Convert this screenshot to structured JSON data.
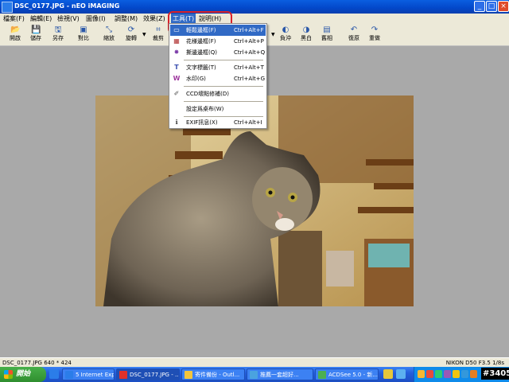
{
  "window": {
    "title": "DSC_0177.JPG - nEO iMAGING",
    "minimize": "_",
    "maximize": "□",
    "close": "×"
  },
  "menubar": {
    "items": [
      "檔案(F)",
      "編輯(E)",
      "檢視(V)",
      "圖像(I)",
      "調整(M)",
      "效果(Z)",
      "工具(T)",
      "說明(H)"
    ]
  },
  "toolbar": {
    "buttons": [
      {
        "label": "開啟",
        "icon": "folder-open-icon",
        "glyph": "📂"
      },
      {
        "label": "儲存",
        "icon": "save-disk-icon",
        "glyph": "💾"
      },
      {
        "label": "另存",
        "icon": "save-as-icon",
        "glyph": "🖫"
      },
      {
        "label": "對比",
        "icon": "compare-icon",
        "glyph": "▣"
      },
      {
        "label": "縮放",
        "icon": "resize-icon",
        "glyph": "⤡"
      },
      {
        "label": "旋轉",
        "icon": "rotate-icon",
        "glyph": "⟳"
      },
      {
        "label": "裁剪",
        "icon": "crop-icon",
        "glyph": "⌗"
      },
      {
        "label": "負沖",
        "icon": "negative-icon",
        "glyph": "◐"
      },
      {
        "label": "黑白",
        "icon": "grayscale-icon",
        "glyph": "◑"
      },
      {
        "label": "舊相",
        "icon": "sepia-icon",
        "glyph": "▤"
      },
      {
        "label": "復原",
        "icon": "undo-icon",
        "glyph": "↶"
      },
      {
        "label": "重做",
        "icon": "redo-icon",
        "glyph": "↷"
      }
    ]
  },
  "tools_menu": {
    "items": [
      {
        "label": "輕鬆邊框(F)",
        "shortcut": "Ctrl+Alt+F",
        "icon": "frame-icon",
        "glyph": "▭",
        "highlighted": true
      },
      {
        "label": "花様邊框(F)",
        "shortcut": "Ctrl+Alt+P",
        "icon": "pattern-frame-icon",
        "glyph": "▦",
        "highlighted": false
      },
      {
        "label": "撕邊邊框(Q)",
        "shortcut": "Ctrl+Alt+Q",
        "icon": "torn-frame-icon",
        "glyph": "✸",
        "highlighted": false
      },
      {
        "label": "文字標籤(T)",
        "shortcut": "Ctrl+Alt+T",
        "icon": "text-label-icon",
        "glyph": "T",
        "highlighted": false
      },
      {
        "label": "水印(G)",
        "shortcut": "Ctrl+Alt+G",
        "icon": "watermark-icon",
        "glyph": "W",
        "highlighted": false
      },
      {
        "label": "CCD壞點修補(D)",
        "shortcut": "",
        "icon": "ccd-repair-icon",
        "glyph": "✐",
        "highlighted": false
      },
      {
        "label": "設定爲桌布(W)",
        "shortcut": "",
        "icon": "",
        "glyph": "",
        "highlighted": false
      },
      {
        "label": "EXIF訊息(X)",
        "shortcut": "Ctrl+Alt+I",
        "icon": "exif-info-icon",
        "glyph": "ℹ",
        "highlighted": false
      }
    ]
  },
  "statusbar": {
    "file_info": "DSC_0177.JPG  640 * 424",
    "camera_info": "NIKON D50 F3.5 1/8s"
  },
  "taskbar": {
    "start_label": "開始",
    "tasks": [
      {
        "label": "5 Internet Expl...",
        "color": "#2b7de9",
        "active": false
      },
      {
        "label": "DSC_0177.JPG - ...",
        "color": "#e0312a",
        "active": true
      },
      {
        "label": "寄件備份 - Outl...",
        "color": "#f2c53d",
        "active": false
      },
      {
        "label": "推薦一套超好...",
        "color": "#4aa3df",
        "active": false
      },
      {
        "label": "ACDSee 5.0 - 新...",
        "color": "#4caf50",
        "active": false
      }
    ],
    "clock": "#3405"
  },
  "colors": {
    "title_blue": "#0347c9",
    "menu_highlight": "#316ac5",
    "annotation_red": "#d8222a",
    "workspace_gray": "#a9a9a9"
  }
}
